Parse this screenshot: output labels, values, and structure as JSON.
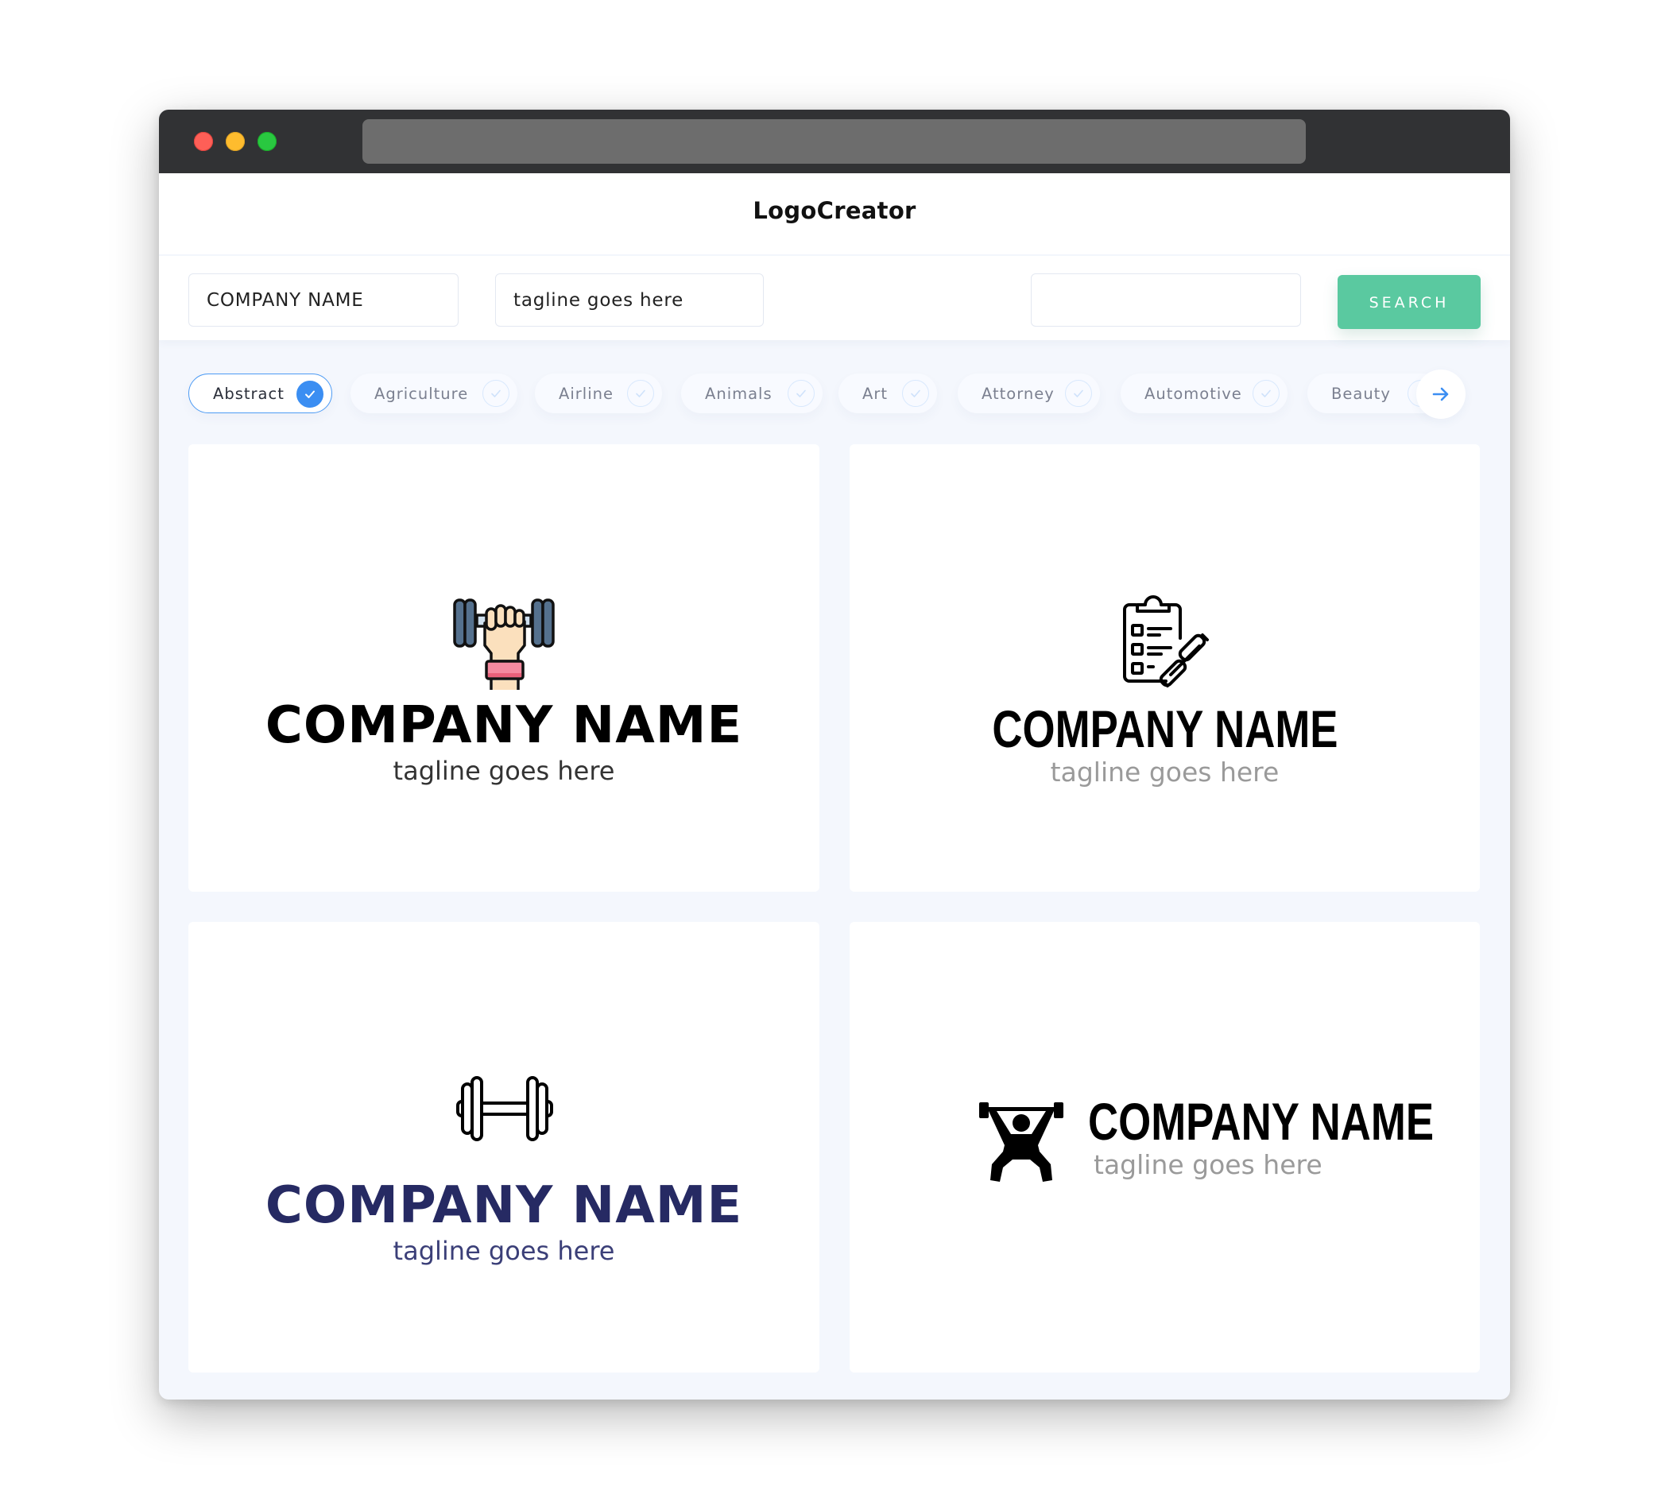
{
  "window": {
    "traffic_lights": [
      "close",
      "minimize",
      "maximize"
    ],
    "url": ""
  },
  "header": {
    "brand": "LogoCreator"
  },
  "toolbar": {
    "company_name_value": "COMPANY NAME",
    "tagline_value": "tagline goes here",
    "keyword_value": "",
    "search_label": "SEARCH"
  },
  "categories": {
    "items": [
      {
        "label": "Abstract",
        "selected": true
      },
      {
        "label": "Agriculture",
        "selected": false
      },
      {
        "label": "Airline",
        "selected": false
      },
      {
        "label": "Animals",
        "selected": false
      },
      {
        "label": "Art",
        "selected": false
      },
      {
        "label": "Attorney",
        "selected": false
      },
      {
        "label": "Automotive",
        "selected": false
      },
      {
        "label": "Beauty",
        "selected": false
      }
    ],
    "next_icon": "arrow-right-icon"
  },
  "colors": {
    "accent_green": "#5ac9a0",
    "accent_blue": "#3b8ef2",
    "navy": "#262a63",
    "titlebar": "#313234"
  },
  "logos": [
    {
      "icon": "hand-dumbbell-icon",
      "name": "COMPANY NAME",
      "tagline": "tagline goes here",
      "name_color": "#000000",
      "tagline_color": "#333333"
    },
    {
      "icon": "clipboard-dumbbell-icon",
      "name": "COMPANY NAME",
      "tagline": "tagline goes here",
      "name_color": "#000000",
      "tagline_color": "#9a9a9a"
    },
    {
      "icon": "dumbbell-icon",
      "name": "COMPANY NAME",
      "tagline": "tagline goes here",
      "name_color": "#262a63",
      "tagline_color": "#3b3f78"
    },
    {
      "icon": "weightlifter-icon",
      "name": "COMPANY NAME",
      "tagline": "tagline goes here",
      "name_color": "#000000",
      "tagline_color": "#9a9a9a"
    }
  ]
}
